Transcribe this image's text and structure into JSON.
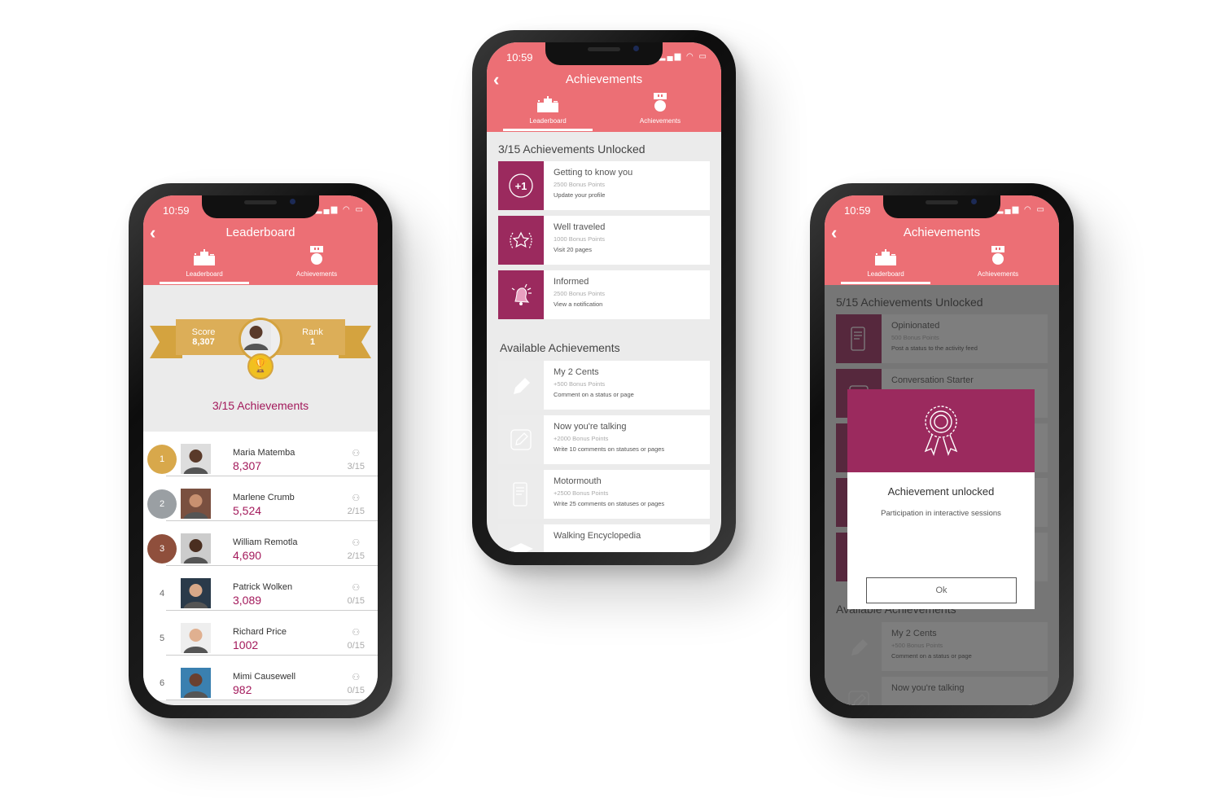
{
  "status": {
    "time": "10:59"
  },
  "colors": {
    "header": "#ec6f75",
    "accent": "#9b2a5e",
    "points": "#a3195b",
    "gold": "#d8a84b",
    "silver": "#9a9fa3",
    "bronze": "#8f4f3c"
  },
  "tabs": {
    "leaderboard": "Leaderboard",
    "achievements": "Achievements"
  },
  "leaderboard_screen": {
    "title": "Leaderboard",
    "score_label": "Score",
    "score_value": "8,307",
    "rank_label": "Rank",
    "rank_value": "1",
    "achievements_summary": "3/15 Achievements",
    "rows": [
      {
        "rank": "1",
        "name": "Maria Matemba",
        "points": "8,307",
        "achievements": "3/15",
        "medal": "gold"
      },
      {
        "rank": "2",
        "name": "Marlene Crumb",
        "points": "5,524",
        "achievements": "2/15",
        "medal": "silver"
      },
      {
        "rank": "3",
        "name": "William Remotla",
        "points": "4,690",
        "achievements": "2/15",
        "medal": "bronze"
      },
      {
        "rank": "4",
        "name": "Patrick Wolken",
        "points": "3,089",
        "achievements": "0/15",
        "medal": ""
      },
      {
        "rank": "5",
        "name": "Richard Price",
        "points": "1002",
        "achievements": "0/15",
        "medal": ""
      },
      {
        "rank": "6",
        "name": "Mimi Causewell",
        "points": "982",
        "achievements": "0/15",
        "medal": ""
      }
    ]
  },
  "achievements_screen": {
    "title": "Achievements",
    "unlocked_heading": "3/15 Achievements Unlocked",
    "unlocked": [
      {
        "title": "Getting to know you",
        "points": "2500 Bonus Points",
        "desc": "Update your profile",
        "icon": "plus-one-icon"
      },
      {
        "title": "Well traveled",
        "points": "1000 Bonus Points",
        "desc": "Visit 20 pages",
        "icon": "laurel-star-icon"
      },
      {
        "title": "Informed",
        "points": "2500 Bonus Points",
        "desc": "View a notification",
        "icon": "bell-icon"
      }
    ],
    "available_heading": "Available Achievements",
    "available": [
      {
        "title": "My 2 Cents",
        "points": "+500 Bonus Points",
        "desc": "Comment on a status or page",
        "icon": "pencil-icon"
      },
      {
        "title": "Now you're talking",
        "points": "+2000 Bonus Points",
        "desc": "Write 10 comments on statuses or pages",
        "icon": "edit-icon"
      },
      {
        "title": "Motormouth",
        "points": "+2500 Bonus Points",
        "desc": "Write 25 comments on statuses or pages",
        "icon": "phone-chat-icon"
      },
      {
        "title": "Walking Encyclopedia",
        "points": "",
        "desc": "",
        "icon": "graduation-cap-icon"
      }
    ]
  },
  "modal_screen": {
    "title": "Achievements",
    "unlocked_heading": "5/15 Achievements Unlocked",
    "unlocked": [
      {
        "title": "Opinionated",
        "points": "500 Bonus Points",
        "desc": "Post a status to the activity feed",
        "icon": "phone-feed-icon"
      },
      {
        "title": "Conversation Starter",
        "points": "",
        "desc": "",
        "icon": "chat-icon"
      },
      {
        "title": "",
        "points": "",
        "desc": "",
        "icon": ""
      },
      {
        "title": "",
        "points": "",
        "desc": "",
        "icon": ""
      },
      {
        "title": "",
        "points": "",
        "desc": "",
        "icon": ""
      }
    ],
    "available_heading": "Available Achievements",
    "available": [
      {
        "title": "My 2 Cents",
        "points": "+500 Bonus Points",
        "desc": "Comment on a status or page",
        "icon": "pencil-icon"
      },
      {
        "title": "Now you're talking",
        "points": "",
        "desc": "",
        "icon": "edit-icon"
      }
    ],
    "dialog": {
      "title": "Achievement unlocked",
      "message": "Participation in interactive sessions",
      "ok_label": "Ok",
      "icon": "rosette-icon"
    }
  }
}
